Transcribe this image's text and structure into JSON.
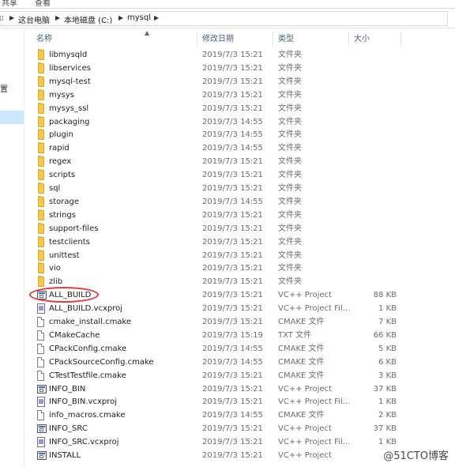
{
  "ribbon": {
    "tab1": "共享",
    "tab2": "查看"
  },
  "address": {
    "parts": [
      "这台电脑",
      "本地磁盘 (C:)",
      "mysql"
    ]
  },
  "left_pane": {
    "label": "置"
  },
  "columns": {
    "name": "名称",
    "date": "修改日期",
    "type": "类型",
    "size": "大小"
  },
  "files": [
    {
      "name": "libmysqld",
      "date": "2019/7/3 15:21",
      "type": "文件夹",
      "size": "",
      "icon": "folder-icon"
    },
    {
      "name": "libservices",
      "date": "2019/7/3 15:21",
      "type": "文件夹",
      "size": "",
      "icon": "folder-icon"
    },
    {
      "name": "mysql-test",
      "date": "2019/7/3 15:21",
      "type": "文件夹",
      "size": "",
      "icon": "folder-icon"
    },
    {
      "name": "mysys",
      "date": "2019/7/3 15:21",
      "type": "文件夹",
      "size": "",
      "icon": "folder-icon"
    },
    {
      "name": "mysys_ssl",
      "date": "2019/7/3 15:21",
      "type": "文件夹",
      "size": "",
      "icon": "folder-icon"
    },
    {
      "name": "packaging",
      "date": "2019/7/3 14:55",
      "type": "文件夹",
      "size": "",
      "icon": "folder-icon"
    },
    {
      "name": "plugin",
      "date": "2019/7/3 14:55",
      "type": "文件夹",
      "size": "",
      "icon": "folder-icon"
    },
    {
      "name": "rapid",
      "date": "2019/7/3 14:55",
      "type": "文件夹",
      "size": "",
      "icon": "folder-icon"
    },
    {
      "name": "regex",
      "date": "2019/7/3 15:21",
      "type": "文件夹",
      "size": "",
      "icon": "folder-icon"
    },
    {
      "name": "scripts",
      "date": "2019/7/3 15:21",
      "type": "文件夹",
      "size": "",
      "icon": "folder-icon"
    },
    {
      "name": "sql",
      "date": "2019/7/3 15:21",
      "type": "文件夹",
      "size": "",
      "icon": "folder-icon"
    },
    {
      "name": "storage",
      "date": "2019/7/3 14:55",
      "type": "文件夹",
      "size": "",
      "icon": "folder-icon"
    },
    {
      "name": "strings",
      "date": "2019/7/3 15:21",
      "type": "文件夹",
      "size": "",
      "icon": "folder-icon"
    },
    {
      "name": "support-files",
      "date": "2019/7/3 15:21",
      "type": "文件夹",
      "size": "",
      "icon": "folder-icon"
    },
    {
      "name": "testclients",
      "date": "2019/7/3 15:21",
      "type": "文件夹",
      "size": "",
      "icon": "folder-icon"
    },
    {
      "name": "unittest",
      "date": "2019/7/3 15:21",
      "type": "文件夹",
      "size": "",
      "icon": "folder-icon"
    },
    {
      "name": "vio",
      "date": "2019/7/3 15:21",
      "type": "文件夹",
      "size": "",
      "icon": "folder-icon"
    },
    {
      "name": "zlib",
      "date": "2019/7/3 15:21",
      "type": "文件夹",
      "size": "",
      "icon": "folder-icon"
    },
    {
      "name": "ALL_BUILD",
      "date": "2019/7/3 15:21",
      "type": "VC++ Project",
      "size": "88 KB",
      "icon": "vc-project-icon"
    },
    {
      "name": "ALL_BUILD.vcxproj",
      "date": "2019/7/3 15:21",
      "type": "VC++ Project Fil...",
      "size": "1 KB",
      "icon": "vcxproj-file-icon"
    },
    {
      "name": "cmake_install.cmake",
      "date": "2019/7/3 15:21",
      "type": "CMAKE 文件",
      "size": "7 KB",
      "icon": "document-icon"
    },
    {
      "name": "CMakeCache",
      "date": "2019/7/3 15:19",
      "type": "TXT 文件",
      "size": "66 KB",
      "icon": "document-icon"
    },
    {
      "name": "CPackConfig.cmake",
      "date": "2019/7/3 14:55",
      "type": "CMAKE 文件",
      "size": "5 KB",
      "icon": "document-icon"
    },
    {
      "name": "CPackSourceConfig.cmake",
      "date": "2019/7/3 14:55",
      "type": "CMAKE 文件",
      "size": "6 KB",
      "icon": "document-icon"
    },
    {
      "name": "CTestTestfile.cmake",
      "date": "2019/7/3 15:21",
      "type": "CMAKE 文件",
      "size": "3 KB",
      "icon": "document-icon"
    },
    {
      "name": "INFO_BIN",
      "date": "2019/7/3 15:21",
      "type": "VC++ Project",
      "size": "37 KB",
      "icon": "vc-project-icon"
    },
    {
      "name": "INFO_BIN.vcxproj",
      "date": "2019/7/3 15:21",
      "type": "VC++ Project Fil...",
      "size": "1 KB",
      "icon": "vcxproj-file-icon"
    },
    {
      "name": "info_macros.cmake",
      "date": "2019/7/3 14:55",
      "type": "CMAKE 文件",
      "size": "2 KB",
      "icon": "document-icon"
    },
    {
      "name": "INFO_SRC",
      "date": "2019/7/3 15:21",
      "type": "VC++ Project",
      "size": "37 KB",
      "icon": "vc-project-icon"
    },
    {
      "name": "INFO_SRC.vcxproj",
      "date": "2019/7/3 15:21",
      "type": "VC++ Project Fil...",
      "size": "1 KB",
      "icon": "vcxproj-file-icon"
    },
    {
      "name": "INSTALL",
      "date": "2019/7/3 15:21",
      "type": "VC++ Project",
      "size": "",
      "icon": "vc-project-icon"
    }
  ],
  "watermark": "@51CTO博客",
  "colors": {
    "header_text": "#4c607a",
    "folder": "#f2c94c",
    "highlight_circle": "#e23b3b",
    "selection": "#cce8ff"
  }
}
